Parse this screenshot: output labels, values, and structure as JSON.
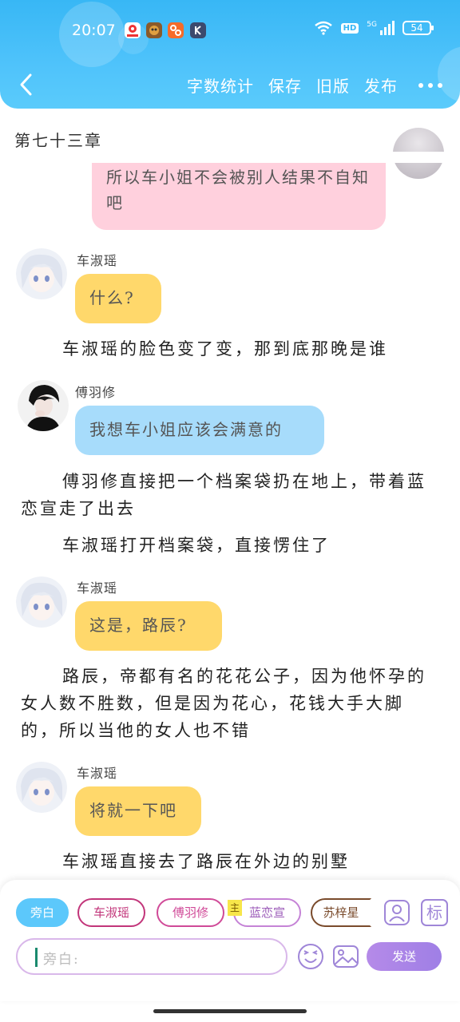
{
  "status_bar": {
    "time": "20:07",
    "hd": "HD",
    "signal": "5G",
    "battery": "54"
  },
  "header": {
    "back_icon": "chevron-left-icon",
    "nav": [
      "字数统计",
      "保存",
      "旧版",
      "发布"
    ],
    "more_icon": "more-dots-icon"
  },
  "chapter_title": "第七十三章",
  "messages": [
    {
      "text": "所以车小姐不会被别人结果不自知吧"
    },
    {
      "speaker": "车淑瑶",
      "text": "什么?"
    },
    {
      "narration": "车淑瑶的脸色变了变，那到底那晚是谁"
    },
    {
      "speaker": "傅羽修",
      "text": "我想车小姐应该会满意的"
    },
    {
      "narration": "傅羽修直接把一个档案袋扔在地上，带着蓝恋宣走了出去"
    },
    {
      "narration": "车淑瑶打开档案袋，直接愣住了"
    },
    {
      "speaker": "车淑瑶",
      "text": "这是，路辰?"
    },
    {
      "narration": "路辰，帝都有名的花花公子，因为他怀孕的女人数不胜数，但是因为花心，花钱大手大脚的，所以当他的女人也不错"
    },
    {
      "speaker": "车淑瑶",
      "text": "将就一下吧"
    },
    {
      "narration": "车淑瑶直接去了路辰在外边的别墅"
    }
  ],
  "composer": {
    "chips": [
      "旁白",
      "车淑瑶",
      "傅羽修",
      "蓝恋宣",
      "苏梓星"
    ],
    "main_badge": "主",
    "mark_label": "标",
    "placeholder": "旁白:",
    "send_label": "发送"
  },
  "colors": {
    "header": "#4fc3fb",
    "bubble_pink": "#ffd0dd",
    "bubble_yellow": "#ffd86b",
    "bubble_blue": "#a7dcfb",
    "accent_purple": "#a984e8"
  }
}
